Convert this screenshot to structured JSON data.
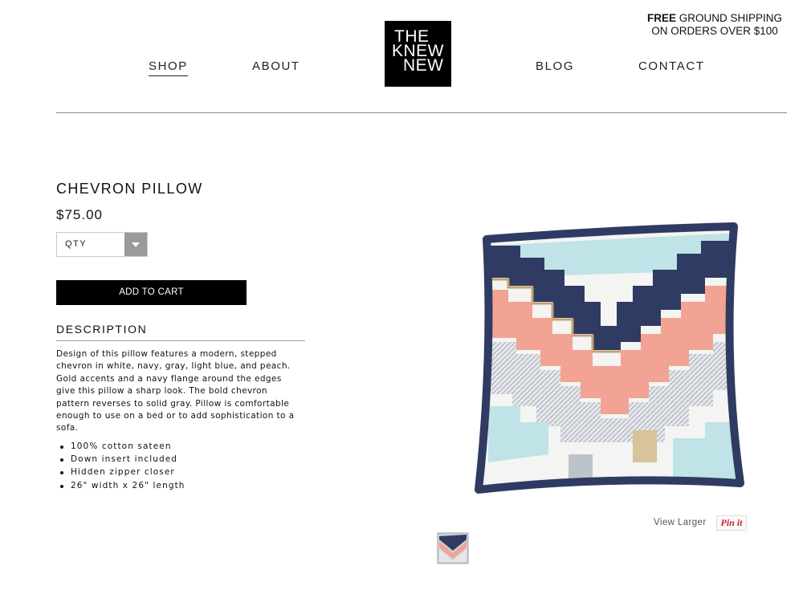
{
  "header": {
    "nav_left": [
      {
        "label": "SHOP",
        "active": true
      },
      {
        "label": "ABOUT",
        "active": false
      }
    ],
    "nav_right": [
      {
        "label": "BLOG"
      },
      {
        "label": "CONTACT"
      }
    ],
    "logo_lines": [
      "THE",
      "KNEW",
      "NEW"
    ],
    "shipping": {
      "bold": "FREE",
      "line1_rest": " GROUND SHIPPING",
      "line2": "ON ORDERS OVER $100"
    }
  },
  "product": {
    "title": "CHEVRON PILLOW",
    "price": "$75.00",
    "qty_label": "QTY",
    "add_to_cart": "ADD TO CART",
    "description_heading": "DESCRIPTION",
    "description": "Design of this pillow features a modern, stepped chevron in white, navy, gray, light blue, and peach. Gold accents and a navy flange around the edges give this pillow a sharp look. The bold chevron pattern reverses to solid gray. Pillow is comfortable enough to use on a bed or to add sophistication to a sofa.",
    "features": [
      "100% cotton sateen",
      "Down insert included",
      "Hidden zipper closer",
      "26\" width x 26\" length"
    ]
  },
  "image": {
    "view_larger": "View Larger",
    "pin_label": "Pin it"
  },
  "colors": {
    "navy": "#2f3b62",
    "peach": "#f2a394",
    "gray": "#c9ccd3",
    "light_blue": "#bfe3e6",
    "gold": "#c2a46e",
    "pin_red": "#c8232c"
  }
}
